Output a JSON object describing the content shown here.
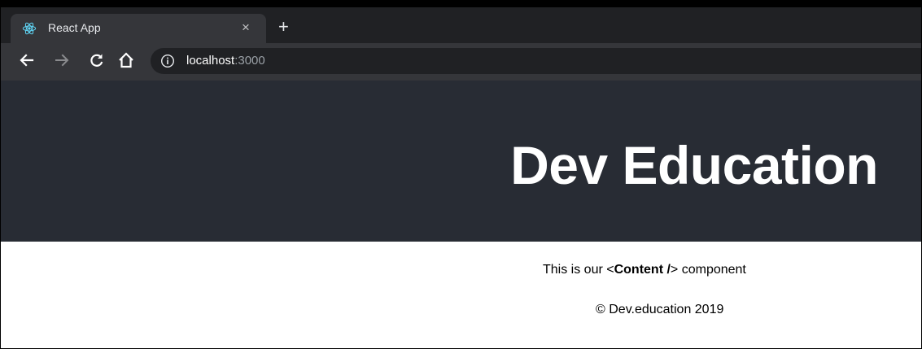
{
  "browser": {
    "tab_title": "React App",
    "tab_close": "×",
    "new_tab": "+",
    "tab_icon": "react-logo-icon",
    "nav": {
      "back_icon": "arrow-left-icon",
      "forward_icon": "arrow-right-icon",
      "reload_icon": "reload-icon",
      "home_icon": "home-icon"
    },
    "address": {
      "info_icon": "info-icon",
      "host": "localhost",
      "port": ":3000"
    }
  },
  "page": {
    "title": "Dev Education",
    "content_prefix": "This is our ",
    "content_open": "<",
    "content_component": "Content /",
    "content_close": ">",
    "content_suffix": " component",
    "footer": "© Dev.education 2019",
    "header_bg": "#282c34"
  }
}
